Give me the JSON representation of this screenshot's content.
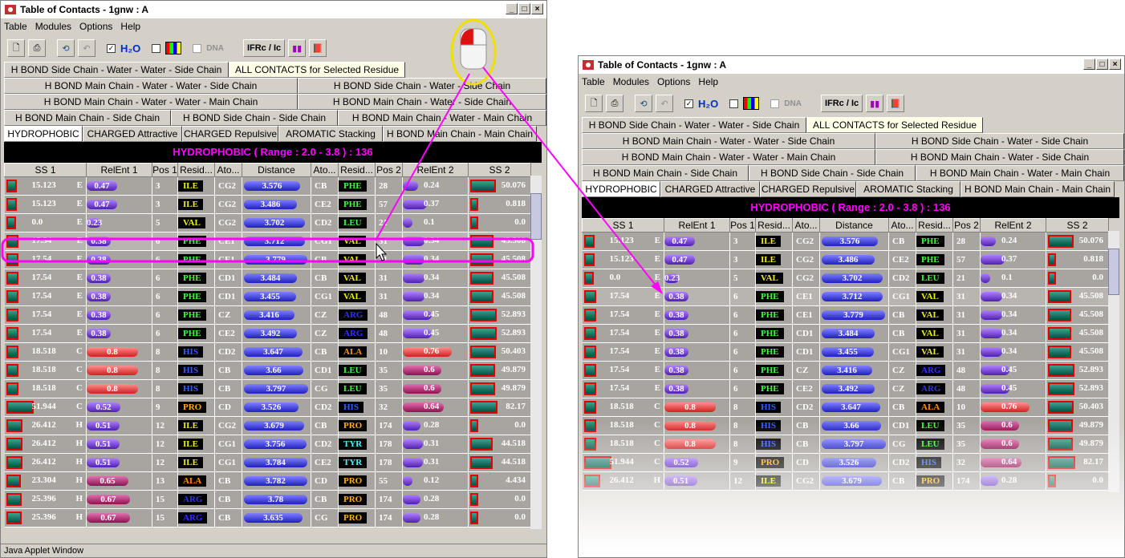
{
  "window_title": "Table of Contacts - 1gnw : A",
  "menu": [
    "Table",
    "Modules",
    "Options",
    "Help"
  ],
  "toolbar": {
    "dna_label": "DNA",
    "ifrc_label": "IFRc / Ic"
  },
  "tab_rows": [
    [
      "H BOND Side Chain - Water - Water - Side Chain",
      "ALL CONTACTS for Selected Residue"
    ],
    [
      "H BOND Main Chain - Water - Water - Side Chain",
      "H BOND Side Chain - Water - Side Chain"
    ],
    [
      "H BOND Main Chain - Water - Water - Main Chain",
      "H BOND Main Chain - Water - Side Chain"
    ],
    [
      "H BOND Main Chain - Side Chain",
      "H BOND Side Chain - Side Chain",
      "H BOND Main Chain - Water - Main Chain"
    ],
    [
      "HYDROPHOBIC",
      "CHARGED Attractive",
      "CHARGED Repulsive",
      "AROMATIC Stacking",
      "H BOND Main Chain - Main Chain"
    ]
  ],
  "header_text": "HYDROPHOBIC ( Range :  2.0 - 3.8 ) :  136",
  "columns": [
    "SS 1",
    "RelEnt 1",
    "Pos 1",
    "Resid...",
    "Ato...",
    "Distance",
    "Ato...",
    "Resid...",
    "Pos 2",
    "RelEnt 2",
    "SS 2"
  ],
  "rows": [
    {
      "ss1": "15.123",
      "t": "E",
      "re1": "0.47",
      "pos1": "3",
      "res1": "ILE",
      "a1": "CG2",
      "dist": "3.576",
      "a2": "CB",
      "res2": "PHE",
      "pos2": "28",
      "re2": "0.24",
      "ss2": "50.076"
    },
    {
      "ss1": "15.123",
      "t": "E",
      "re1": "0.47",
      "pos1": "3",
      "res1": "ILE",
      "a1": "CG2",
      "dist": "3.486",
      "a2": "CE2",
      "res2": "PHE",
      "pos2": "57",
      "re2": "0.37",
      "ss2": "0.818"
    },
    {
      "ss1": "0.0",
      "t": "E",
      "re1": "0.23",
      "pos1": "5",
      "res1": "VAL",
      "a1": "CG2",
      "dist": "3.702",
      "a2": "CD2",
      "res2": "LEU",
      "pos2": "21",
      "re2": "0.1",
      "ss2": "0.0"
    },
    {
      "ss1": "17.54",
      "t": "E",
      "re1": "0.38",
      "pos1": "6",
      "res1": "PHE",
      "a1": "CE1",
      "dist": "3.712",
      "a2": "CG1",
      "res2": "VAL",
      "pos2": "31",
      "re2": "0.34",
      "ss2": "45.508"
    },
    {
      "ss1": "17.54",
      "t": "E",
      "re1": "0.38",
      "pos1": "6",
      "res1": "PHE",
      "a1": "CE1",
      "dist": "3.779",
      "a2": "CB",
      "res2": "VAL",
      "pos2": "31",
      "re2": "0.34",
      "ss2": "45.508"
    },
    {
      "ss1": "17.54",
      "t": "E",
      "re1": "0.38",
      "pos1": "6",
      "res1": "PHE",
      "a1": "CD1",
      "dist": "3.484",
      "a2": "CB",
      "res2": "VAL",
      "pos2": "31",
      "re2": "0.34",
      "ss2": "45.508"
    },
    {
      "ss1": "17.54",
      "t": "E",
      "re1": "0.38",
      "pos1": "6",
      "res1": "PHE",
      "a1": "CD1",
      "dist": "3.455",
      "a2": "CG1",
      "res2": "VAL",
      "pos2": "31",
      "re2": "0.34",
      "ss2": "45.508"
    },
    {
      "ss1": "17.54",
      "t": "E",
      "re1": "0.38",
      "pos1": "6",
      "res1": "PHE",
      "a1": "CZ",
      "dist": "3.416",
      "a2": "CZ",
      "res2": "ARG",
      "pos2": "48",
      "re2": "0.45",
      "ss2": "52.893"
    },
    {
      "ss1": "17.54",
      "t": "E",
      "re1": "0.38",
      "pos1": "6",
      "res1": "PHE",
      "a1": "CE2",
      "dist": "3.492",
      "a2": "CZ",
      "res2": "ARG",
      "pos2": "48",
      "re2": "0.45",
      "ss2": "52.893"
    },
    {
      "ss1": "18.518",
      "t": "C",
      "re1": "0.8",
      "pos1": "8",
      "res1": "HIS",
      "a1": "CD2",
      "dist": "3.647",
      "a2": "CB",
      "res2": "ALA",
      "pos2": "10",
      "re2": "0.76",
      "ss2": "50.403"
    },
    {
      "ss1": "18.518",
      "t": "C",
      "re1": "0.8",
      "pos1": "8",
      "res1": "HIS",
      "a1": "CB",
      "dist": "3.66",
      "a2": "CD1",
      "res2": "LEU",
      "pos2": "35",
      "re2": "0.6",
      "ss2": "49.879"
    },
    {
      "ss1": "18.518",
      "t": "C",
      "re1": "0.8",
      "pos1": "8",
      "res1": "HIS",
      "a1": "CB",
      "dist": "3.797",
      "a2": "CG",
      "res2": "LEU",
      "pos2": "35",
      "re2": "0.6",
      "ss2": "49.879"
    },
    {
      "ss1": "51.944",
      "t": "C",
      "re1": "0.52",
      "pos1": "9",
      "res1": "PRO",
      "a1": "CD",
      "dist": "3.526",
      "a2": "CD2",
      "res2": "HIS",
      "pos2": "32",
      "re2": "0.64",
      "ss2": "82.17"
    },
    {
      "ss1": "26.412",
      "t": "H",
      "re1": "0.51",
      "pos1": "12",
      "res1": "ILE",
      "a1": "CG2",
      "dist": "3.679",
      "a2": "CB",
      "res2": "PRO",
      "pos2": "174",
      "re2": "0.28",
      "ss2": "0.0"
    },
    {
      "ss1": "26.412",
      "t": "H",
      "re1": "0.51",
      "pos1": "12",
      "res1": "ILE",
      "a1": "CG1",
      "dist": "3.756",
      "a2": "CD2",
      "res2": "TYR",
      "pos2": "178",
      "re2": "0.31",
      "ss2": "44.518"
    },
    {
      "ss1": "26.412",
      "t": "H",
      "re1": "0.51",
      "pos1": "12",
      "res1": "ILE",
      "a1": "CG1",
      "dist": "3.784",
      "a2": "CE2",
      "res2": "TYR",
      "pos2": "178",
      "re2": "0.31",
      "ss2": "44.518"
    },
    {
      "ss1": "23.304",
      "t": "H",
      "re1": "0.65",
      "pos1": "13",
      "res1": "ALA",
      "a1": "CB",
      "dist": "3.782",
      "a2": "CD",
      "res2": "PRO",
      "pos2": "55",
      "re2": "0.12",
      "ss2": "4.434"
    },
    {
      "ss1": "25.396",
      "t": "H",
      "re1": "0.67",
      "pos1": "15",
      "res1": "ARG",
      "a1": "CB",
      "dist": "3.78",
      "a2": "CB",
      "res2": "PRO",
      "pos2": "174",
      "re2": "0.28",
      "ss2": "0.0"
    },
    {
      "ss1": "25.396",
      "t": "H",
      "re1": "0.67",
      "pos1": "15",
      "res1": "ARG",
      "a1": "CB",
      "dist": "3.635",
      "a2": "CG",
      "res2": "PRO",
      "pos2": "174",
      "re2": "0.28",
      "ss2": "0.0"
    }
  ],
  "status_text": "Java Applet Window",
  "colors": {
    "highlight": "#ff00ff",
    "annotation": "#f0e000",
    "header_bg": "#000000"
  }
}
